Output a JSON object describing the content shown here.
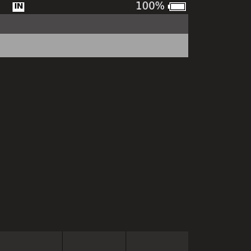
{
  "status_bar": {
    "input_mode": "IN",
    "battery_percent": "100%",
    "battery_icon": "battery-full-icon"
  },
  "header": {
    "title": ""
  },
  "list": {
    "items": [
      {
        "label": "",
        "selected": true
      }
    ]
  },
  "softkeys": {
    "left": "",
    "center": "",
    "right": ""
  },
  "colors": {
    "background": "#221f1f",
    "header": "#4a4848",
    "selection": "#a4a3a3",
    "softkey_bar": "#2f2c2c",
    "text": "#ffffff"
  }
}
